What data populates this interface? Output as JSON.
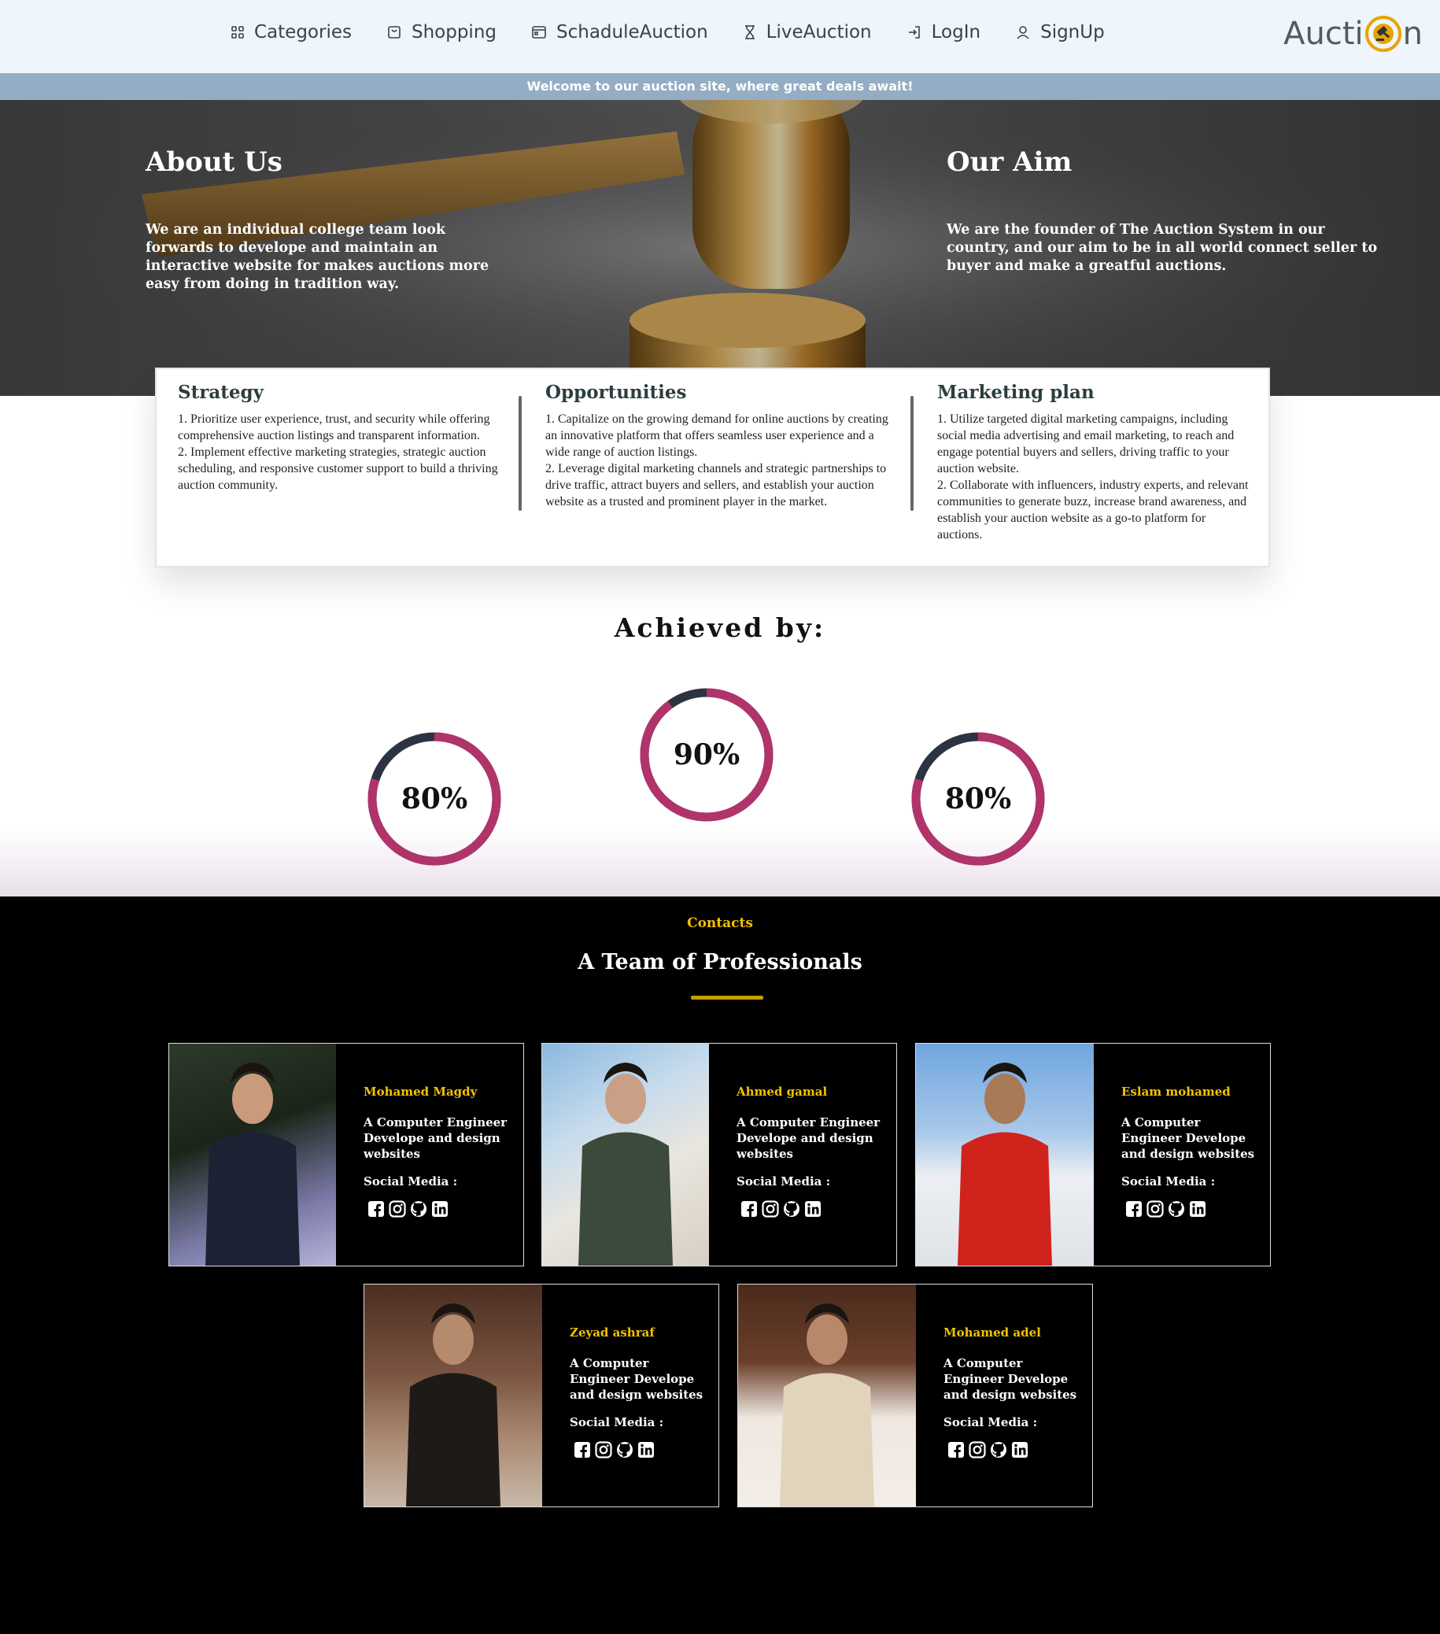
{
  "nav": {
    "items": [
      {
        "label": "Categories",
        "icon": "grid-icon"
      },
      {
        "label": "Shopping",
        "icon": "bag-icon"
      },
      {
        "label": "SchaduleAuction",
        "icon": "calendar-icon"
      },
      {
        "label": "LiveAuction",
        "icon": "hourglass-icon"
      },
      {
        "label": "LogIn",
        "icon": "login-icon"
      },
      {
        "label": "SignUp",
        "icon": "user-icon"
      }
    ],
    "logo_left": "Aucti",
    "logo_right": "n"
  },
  "banner": "Welcome to our auction site, where great deals await!",
  "hero": {
    "about_title": "About Us",
    "about_text": "We are an individual college team look forwards to develope and maintain an interactive website for makes auctions more easy from doing in tradition way.",
    "aim_title": "Our Aim",
    "aim_text": "We are the founder of The Auction System in our country, and our aim to be in all world connect seller to buyer and make a greatful auctions."
  },
  "plans": [
    {
      "title": "Strategy",
      "text": "1. Prioritize user experience, trust, and security while offering comprehensive auction listings and transparent information.\n2. Implement effective marketing strategies, strategic auction scheduling, and responsive customer support to build a thriving auction community."
    },
    {
      "title": "Opportunities",
      "text": "1. Capitalize on the growing demand for online auctions by creating an innovative platform that offers seamless user experience and a wide range of auction listings.\n2. Leverage digital marketing channels and strategic partnerships to drive traffic, attract buyers and sellers, and establish your auction website as a trusted and prominent player in the market."
    },
    {
      "title": "Marketing plan",
      "text": "1. Utilize targeted digital marketing campaigns, including social media advertising and email marketing, to reach and engage potential buyers and sellers, driving traffic to your auction website.\n2. Collaborate with influencers, industry experts, and relevant communities to generate buzz, increase brand awareness, and establish your auction website as a go-to platform for auctions."
    }
  ],
  "achieved": {
    "title": "Achieved by:",
    "rings": [
      {
        "label": "80%",
        "value": 0.8
      },
      {
        "label": "90%",
        "value": 0.9
      },
      {
        "label": "80%",
        "value": 0.8
      }
    ],
    "colors": {
      "progress": "#b0346a",
      "track": "#2b3440"
    }
  },
  "team": {
    "kicker": "Contacts",
    "title": "A Team of Professionals",
    "social_label": "Social Media :",
    "members": [
      {
        "name": "Mohamed Magdy",
        "role": "A Computer Engineer Develope and design websites"
      },
      {
        "name": "Ahmed gamal",
        "role": "A Computer Engineer Develope and design websites"
      },
      {
        "name": "Eslam mohamed",
        "role": "A Computer Engineer Develope and design websites"
      },
      {
        "name": "Zeyad ashraf",
        "role": "A Computer Engineer Develope and design websites"
      },
      {
        "name": "Mohamed adel",
        "role": "A Computer Engineer Develope and design websites"
      }
    ],
    "social_icons": [
      "facebook-icon",
      "instagram-icon",
      "github-icon",
      "linkedin-icon"
    ]
  }
}
